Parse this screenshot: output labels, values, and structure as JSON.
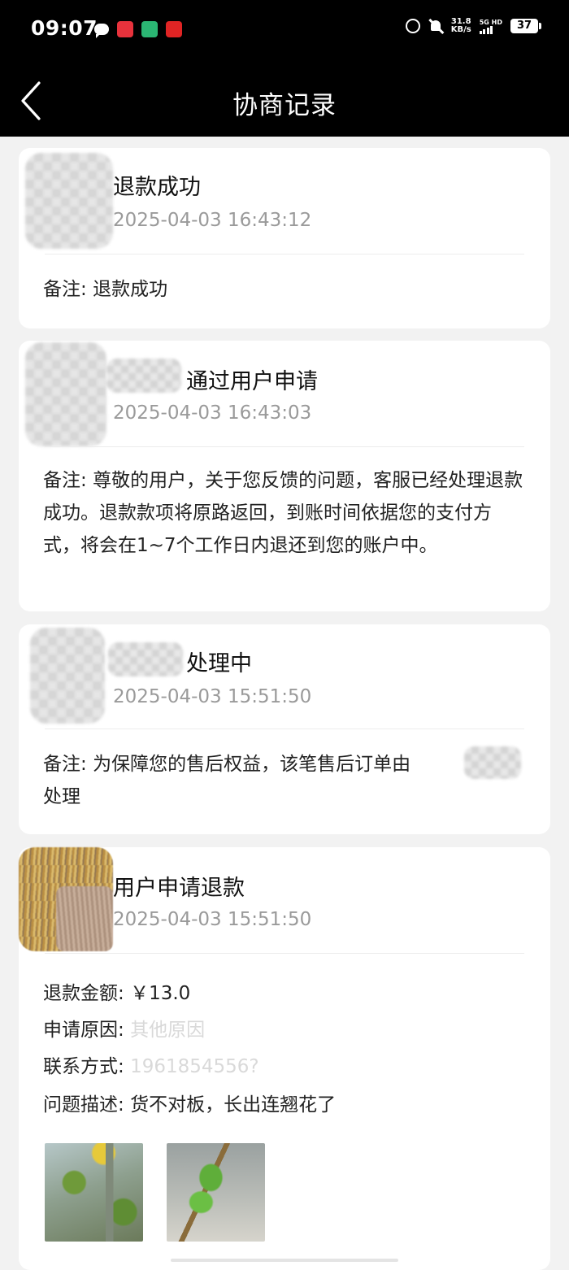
{
  "status_bar": {
    "time": "09:07",
    "net_speed_value": "31.8",
    "net_speed_unit": "KB/s",
    "network_top": "5G HD",
    "battery": "37",
    "colors": {
      "app1": "#e8323c",
      "app2": "#2bb673",
      "app3": "#e02424"
    }
  },
  "header": {
    "title": "协商记录",
    "back_icon": "chevron-left-icon"
  },
  "records": [
    {
      "title": "退款成功",
      "time": "2025-04-03 16:43:12",
      "note_label": "备注: ",
      "note": "退款成功"
    },
    {
      "title": "通过用户申请",
      "time": "2025-04-03 16:43:03",
      "note_label": "备注: ",
      "note": "尊敬的用户，关于您反馈的问题，客服已经处理退款成功。退款款项将原路返回，到账时间依据您的支付方式，将会在1~7个工作日内退还到您的账户中。"
    },
    {
      "title": "处理中",
      "time": "2025-04-03 15:51:50",
      "note_label": "备注: ",
      "note": "为保障您的售后权益，该笔售后订单由",
      "note_end": "处理"
    },
    {
      "title": "用户申请退款",
      "time": "2025-04-03 15:51:50",
      "fields": {
        "amount_label": "退款金额: ",
        "amount": "￥13.0",
        "reason_label": "申请原因: ",
        "reason": "其他原因",
        "contact_label": "联系方式: ",
        "contact": "1961854556?",
        "desc_label": "问题描述: ",
        "desc": "货不对板，长出连翘花了"
      }
    }
  ]
}
